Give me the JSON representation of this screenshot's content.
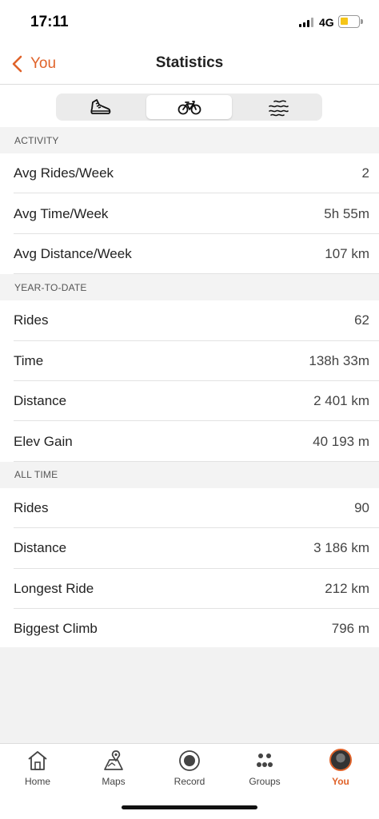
{
  "status_bar": {
    "time": "17:11",
    "network": "4G"
  },
  "nav": {
    "back_label": "You",
    "title": "Statistics"
  },
  "segments": [
    {
      "icon": "running-shoe-icon",
      "active": false
    },
    {
      "icon": "bike-icon",
      "active": true
    },
    {
      "icon": "swim-icon",
      "active": false
    }
  ],
  "sections": {
    "activity": {
      "header": "ACTIVITY",
      "rows": [
        {
          "label": "Avg Rides/Week",
          "value": "2"
        },
        {
          "label": "Avg Time/Week",
          "value": "5h 55m"
        },
        {
          "label": "Avg Distance/Week",
          "value": "107 km"
        }
      ]
    },
    "ytd": {
      "header": "YEAR-TO-DATE",
      "rows": [
        {
          "label": "Rides",
          "value": "62"
        },
        {
          "label": "Time",
          "value": "138h 33m"
        },
        {
          "label": "Distance",
          "value": "2 401 km"
        },
        {
          "label": "Elev Gain",
          "value": "40 193 m"
        }
      ]
    },
    "all_time": {
      "header": "ALL TIME",
      "rows": [
        {
          "label": "Rides",
          "value": "90"
        },
        {
          "label": "Distance",
          "value": "3 186 km"
        },
        {
          "label": "Longest Ride",
          "value": "212 km"
        },
        {
          "label": "Biggest Climb",
          "value": "796 m"
        }
      ]
    }
  },
  "tabbar": {
    "home": "Home",
    "maps": "Maps",
    "record": "Record",
    "groups": "Groups",
    "you": "You"
  },
  "colors": {
    "accent": "#e0632a",
    "battery": "#f5c518"
  }
}
